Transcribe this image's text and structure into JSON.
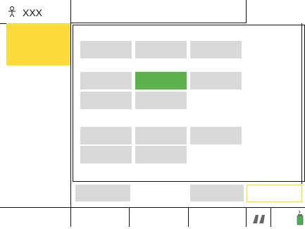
{
  "header": {
    "title": "XXX",
    "icon": "user-icon"
  },
  "sidebar": {
    "selected_color": "#FDDB3A"
  },
  "main": {
    "accent_color": "#5DB14E",
    "highlight_button_border": "#E8D96B"
  },
  "footer": {
    "icons": [
      "quote-icon",
      "battery-icon"
    ],
    "battery_color": "#4CAF50"
  }
}
